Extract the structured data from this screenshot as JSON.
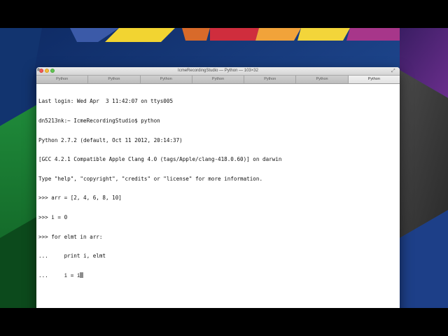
{
  "window": {
    "title": "IcmeRecordingStudio — Python — 103×32"
  },
  "tabs": [
    {
      "label": "Python",
      "active": false
    },
    {
      "label": "Python",
      "active": false
    },
    {
      "label": "Python",
      "active": false
    },
    {
      "label": "Python",
      "active": false
    },
    {
      "label": "Python",
      "active": false
    },
    {
      "label": "Python",
      "active": false
    },
    {
      "label": "Python",
      "active": true
    }
  ],
  "terminal": {
    "lines": [
      "Last login: Wed Apr  3 11:42:07 on ttys005",
      "dn5213nk:~ IcmeRecordingStudio$ python",
      "Python 2.7.2 (default, Oct 11 2012, 20:14:37)",
      "[GCC 4.2.1 Compatible Apple Clang 4.0 (tags/Apple/clang-418.0.60)] on darwin",
      "Type \"help\", \"copyright\", \"credits\" or \"license\" for more information.",
      ">>> arr = [2, 4, 6, 8, 10]",
      ">>> i = 0",
      ">>> for elmt in arr:",
      "...     print i, elmt",
      "...     i = i"
    ]
  },
  "colors": {
    "terminal_bg": "#ffffff",
    "terminal_fg": "#111111",
    "cursor": "#8c8c8c"
  }
}
